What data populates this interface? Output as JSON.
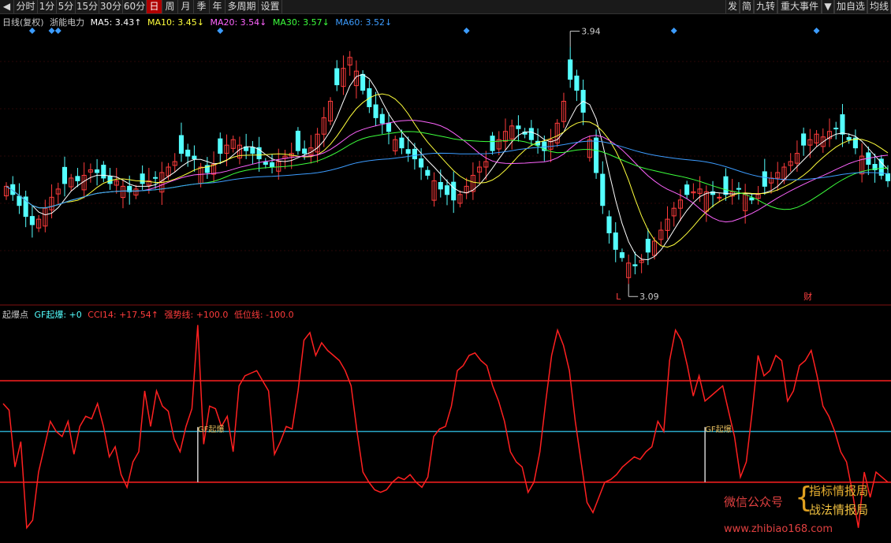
{
  "toolbar": {
    "left": [
      {
        "id": "back",
        "label": "◀",
        "w": 18
      },
      {
        "id": "fenshi",
        "label": "分时",
        "w": 30
      },
      {
        "id": "1fen",
        "label": "1分",
        "w": 24
      },
      {
        "id": "5fen",
        "label": "5分",
        "w": 24
      },
      {
        "id": "15fen",
        "label": "15分",
        "w": 30
      },
      {
        "id": "30fen",
        "label": "30分",
        "w": 30
      },
      {
        "id": "60fen",
        "label": "60分",
        "w": 30
      },
      {
        "id": "ri",
        "label": "日",
        "w": 20,
        "active": true
      },
      {
        "id": "zhou",
        "label": "周",
        "w": 20
      },
      {
        "id": "yue",
        "label": "月",
        "w": 20
      },
      {
        "id": "ji",
        "label": "季",
        "w": 20
      },
      {
        "id": "nian",
        "label": "年",
        "w": 20
      },
      {
        "id": "duozhouqi",
        "label": "多周期",
        "w": 42
      },
      {
        "id": "shezhi",
        "label": "设置",
        "w": 30
      }
    ],
    "right": [
      {
        "id": "fa",
        "label": "发",
        "w": 18
      },
      {
        "id": "jian",
        "label": "简",
        "w": 18
      },
      {
        "id": "jiuzhuan",
        "label": "九转",
        "w": 30
      },
      {
        "id": "zhongdashijian",
        "label": "重大事件",
        "w": 56
      },
      {
        "id": "dropdown",
        "label": "▼",
        "w": 16
      },
      {
        "id": "jiazixuan",
        "label": "加自选",
        "w": 42
      },
      {
        "id": "junxian",
        "label": "均线",
        "w": 30
      }
    ]
  },
  "info": {
    "mode": "日线(复权)",
    "stock": "浙能电力",
    "ma5": "MA5: 3.43↑",
    "ma10": "MA10: 3.45↓",
    "ma20": "MA20: 3.54↓",
    "ma30": "MA30: 3.57↓",
    "ma60": "MA60: 3.52↓"
  },
  "indicator_info": {
    "name": "起爆点",
    "gf": "GF起爆: +0",
    "cci": "CCI14: +17.54↑",
    "strong": "强势线: +100.0",
    "low": "低位线: -100.0"
  },
  "colors": {
    "up": "#ff3c3c",
    "down": "#54ffff",
    "ma5": "#ffffff",
    "ma10": "#ffff3c",
    "ma20": "#ff64ff",
    "ma30": "#3cff3c",
    "ma60": "#3c9cff",
    "cci": "#ff2020",
    "strong_line": "#ff2020",
    "low_line": "#ff2020",
    "zero_line": "#2aa8c8",
    "diamond": "#3c9cff",
    "grid": "#801010"
  },
  "chart_data": {
    "type": "candlestick",
    "y_range": [
      3.0,
      4.0
    ],
    "high_label": "3.94",
    "low_label": "3.09",
    "low_marker": "L",
    "event_marker": "财",
    "close": [
      3.43,
      3.4,
      3.36,
      3.32,
      3.29,
      3.31,
      3.35,
      3.39,
      3.42,
      3.44,
      3.46,
      3.45,
      3.47,
      3.49,
      3.48,
      3.46,
      3.44,
      3.45,
      3.43,
      3.41,
      3.42,
      3.44,
      3.45,
      3.46,
      3.48,
      3.5,
      3.52,
      3.55,
      3.54,
      3.53,
      3.5,
      3.48,
      3.51,
      3.55,
      3.58,
      3.6,
      3.58,
      3.56,
      3.55,
      3.53,
      3.51,
      3.5,
      3.52,
      3.54,
      3.55,
      3.56,
      3.55,
      3.57,
      3.62,
      3.68,
      3.74,
      3.8,
      3.86,
      3.9,
      3.85,
      3.78,
      3.72,
      3.68,
      3.66,
      3.63,
      3.6,
      3.57,
      3.55,
      3.53,
      3.5,
      3.47,
      3.45,
      3.42,
      3.4,
      3.38,
      3.4,
      3.43,
      3.47,
      3.5,
      3.52,
      3.56,
      3.6,
      3.63,
      3.65,
      3.64,
      3.62,
      3.6,
      3.58,
      3.56,
      3.6,
      3.66,
      3.74,
      3.82,
      3.78,
      3.7,
      3.6,
      3.48,
      3.36,
      3.26,
      3.2,
      3.17,
      3.15,
      3.14,
      3.16,
      3.19,
      3.23,
      3.27,
      3.31,
      3.35,
      3.38,
      3.4,
      3.41,
      3.42,
      3.41,
      3.4,
      3.39,
      3.4,
      3.41,
      3.42,
      3.4,
      3.38,
      3.4,
      3.43,
      3.46,
      3.48,
      3.5,
      3.52,
      3.55,
      3.58,
      3.6,
      3.62,
      3.61,
      3.63,
      3.64,
      3.62,
      3.6,
      3.57,
      3.54,
      3.51,
      3.49,
      3.47,
      3.45
    ],
    "series": [
      {
        "name": "MA5",
        "key": "ma5"
      },
      {
        "name": "MA10",
        "key": "ma10"
      },
      {
        "name": "MA20",
        "key": "ma20"
      },
      {
        "name": "MA30",
        "key": "ma30"
      },
      {
        "name": "MA60",
        "key": "ma60"
      }
    ],
    "diamonds_at": [
      4,
      7,
      8,
      33,
      71,
      103,
      125,
      140,
      154
    ],
    "cci": {
      "range": [
        -220,
        220
      ],
      "strong": 100,
      "low": -100,
      "values": [
        55,
        42,
        -70,
        -20,
        -190,
        -175,
        -80,
        -30,
        20,
        0,
        -10,
        20,
        -45,
        10,
        30,
        25,
        55,
        10,
        -50,
        -30,
        -85,
        -110,
        -60,
        -40,
        80,
        10,
        80,
        50,
        40,
        -15,
        -40,
        10,
        45,
        210,
        -25,
        50,
        45,
        10,
        30,
        -40,
        90,
        110,
        115,
        120,
        100,
        80,
        -45,
        -20,
        10,
        5,
        80,
        180,
        195,
        150,
        175,
        160,
        150,
        140,
        120,
        90,
        0,
        -80,
        -100,
        -115,
        -120,
        -115,
        -100,
        -90,
        -95,
        -85,
        -100,
        -110,
        -90,
        -10,
        5,
        10,
        50,
        120,
        130,
        150,
        155,
        140,
        130,
        90,
        60,
        20,
        -40,
        -60,
        -70,
        -120,
        -100,
        -40,
        60,
        150,
        200,
        170,
        120,
        20,
        -60,
        -140,
        -160,
        -130,
        -100,
        -95,
        -85,
        -70,
        -60,
        -50,
        -55,
        -40,
        -30,
        20,
        0,
        140,
        200,
        180,
        130,
        70,
        110,
        60,
        70,
        80,
        90,
        40,
        -10,
        -90,
        -60,
        40,
        150,
        110,
        120,
        150,
        140,
        60,
        80,
        130,
        140,
        160,
        110,
        50,
        30,
        0,
        -40,
        -60,
        -120,
        -190,
        -80,
        -130,
        -80,
        -90,
        -100
      ],
      "gf_signals": [
        {
          "i": 33,
          "label": "GF起爆"
        },
        {
          "i": 119,
          "label": "GF起爆"
        }
      ]
    }
  },
  "watermark": {
    "wechat": "微信公众号",
    "brace": "{",
    "line1": "指标情报局",
    "line2": "战法情报局",
    "url": "www.zhibiao168.com"
  }
}
